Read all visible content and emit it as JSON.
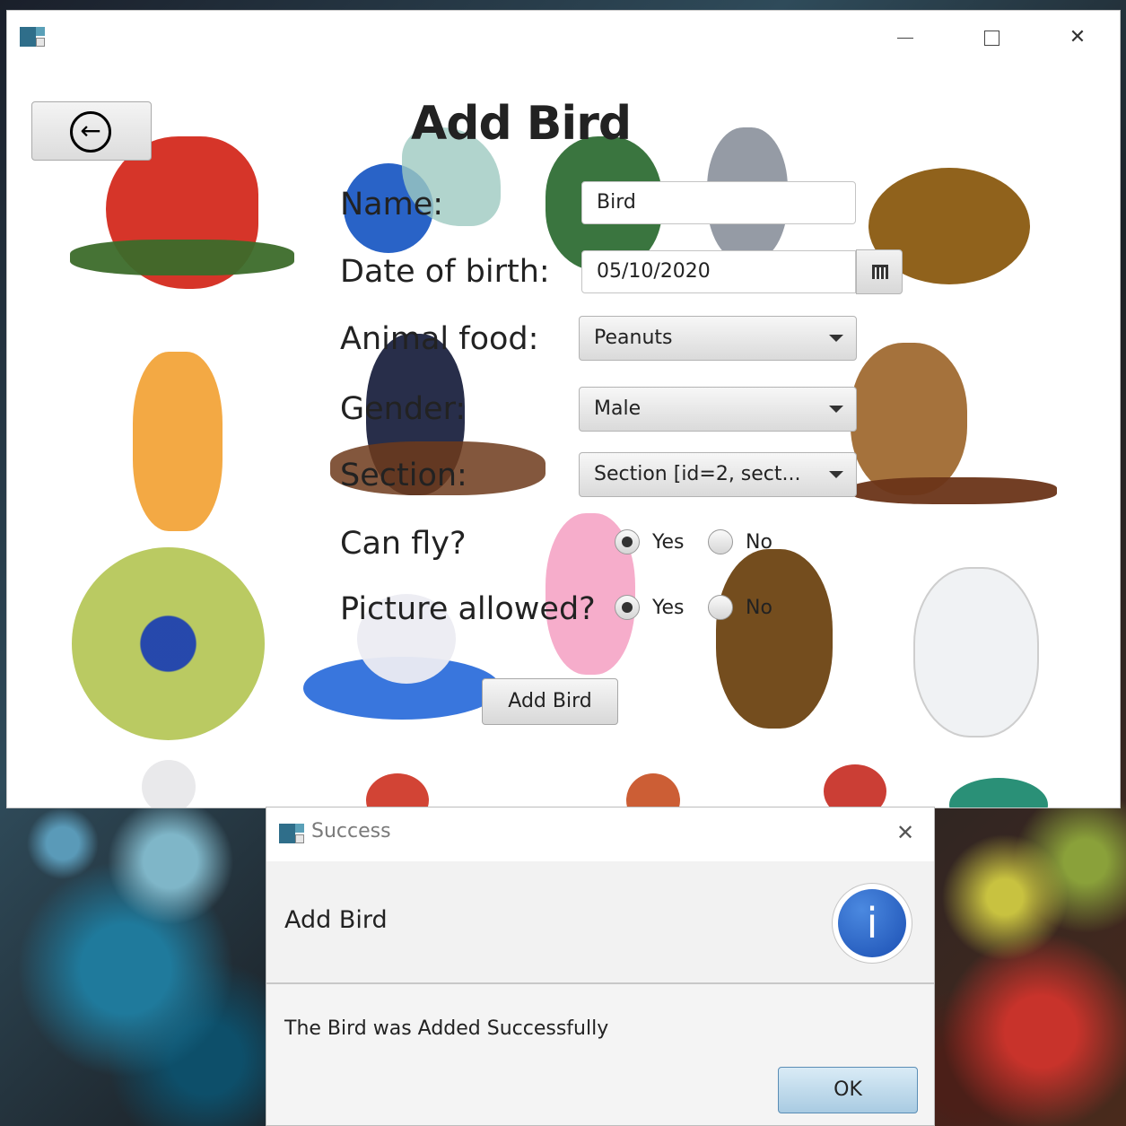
{
  "main_window": {
    "controls": {
      "minimize_icon": "minimize-icon",
      "maximize_icon": "maximize-icon",
      "close_icon": "close-icon"
    }
  },
  "page": {
    "back_icon": "arrow-left-circle-icon",
    "title": "Add Bird"
  },
  "form": {
    "name_label": "Name:",
    "name_value": "Bird",
    "dob_label": "Date of birth:",
    "dob_value": "05/10/2020",
    "food_label": "Animal food:",
    "food_value": "Peanuts",
    "gender_label": "Gender:",
    "gender_value": "Male",
    "section_label": "Section:",
    "section_value": "Section [id=2, sect...",
    "can_fly_label": "Can fly?",
    "can_fly_yes": "Yes",
    "can_fly_no": "No",
    "picture_label": "Picture allowed?",
    "picture_yes": "Yes",
    "picture_no": "No",
    "submit_label": "Add Bird"
  },
  "dialog": {
    "title": "Success",
    "header": "Add Bird",
    "content": "The Bird was Added Successfully",
    "ok_label": "OK"
  },
  "colors": {
    "dialog_ok_accent": "#a9cbe2",
    "info_icon_blue": "#1b4fb3"
  }
}
